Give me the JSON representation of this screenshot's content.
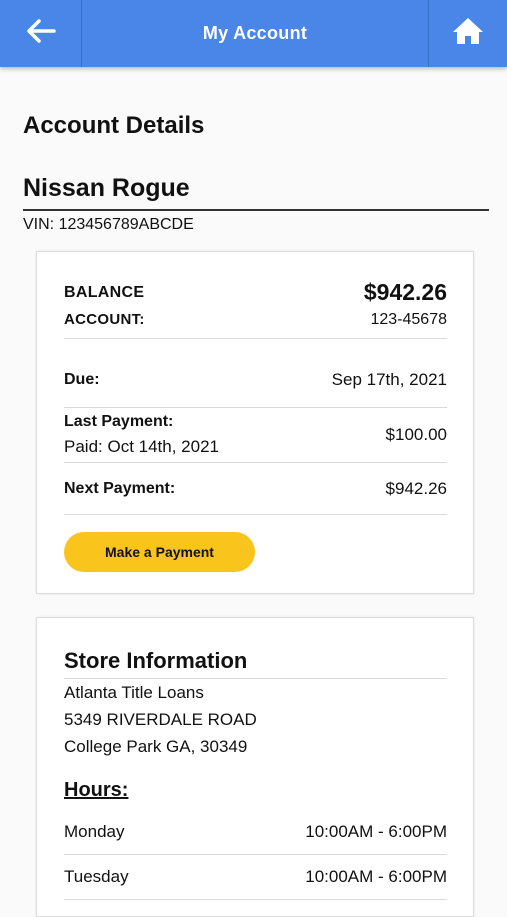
{
  "header": {
    "title": "My Account",
    "back_icon": "arrow-left-icon",
    "home_icon": "home-icon",
    "color": "#4a86e8"
  },
  "account_details": {
    "heading": "Account Details",
    "vehicle": "Nissan Rogue",
    "vin": "VIN: 123456789ABCDE"
  },
  "account_card": {
    "balance_label": "BALANCE",
    "balance_value": "$942.26",
    "account_label": "ACCOUNT:",
    "account_value": "123-45678",
    "due_label": "Due:",
    "due_value": "Sep 17th, 2021",
    "last_payment_label": "Last Payment:",
    "last_payment_paid": "Paid: Oct 14th, 2021",
    "last_payment_value": "$100.00",
    "next_payment_label": "Next Payment:",
    "next_payment_value": "$942.26",
    "button_label": "Make a Payment",
    "button_color": "#f9c51d"
  },
  "store": {
    "title": "Store Information",
    "name": "Atlanta Title Loans",
    "address1": "5349 RIVERDALE ROAD",
    "address2": "College Park GA, 30349",
    "hours_label": "Hours:",
    "hours": [
      {
        "day": "Monday",
        "time": "10:00AM - 6:00PM"
      },
      {
        "day": "Tuesday",
        "time": "10:00AM - 6:00PM"
      }
    ]
  }
}
